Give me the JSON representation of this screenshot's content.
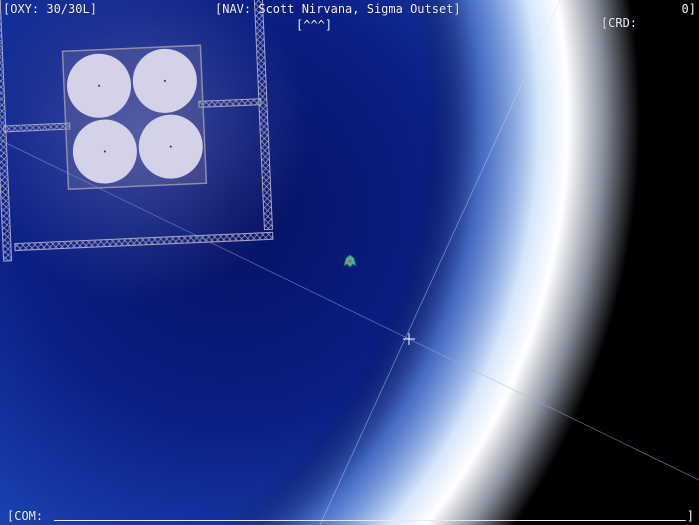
{
  "hud": {
    "oxygen_text": "[OXY: 30/30L]",
    "nav_text": "[NAV: Scott Nirvana, Sigma Outset]",
    "heading_indicator": "[^^^]",
    "credits_label": "[CRD:",
    "credits_value": "0]",
    "com_label": "[COM:",
    "com_close": "]"
  },
  "colors": {
    "space_deep": "#061466",
    "space_mid": "#1a3aa8",
    "atmosphere_glow": "#ffffff",
    "hud_text": "#f4f4ff",
    "station_frame": "#9a98b8",
    "tank": "#d4d2e8",
    "player_ship": "#3fb8a0"
  },
  "scene": {
    "station": "orbital-station",
    "tank_count": 4,
    "player": "player-ship",
    "crosshair": "waypoint-crosshair"
  }
}
